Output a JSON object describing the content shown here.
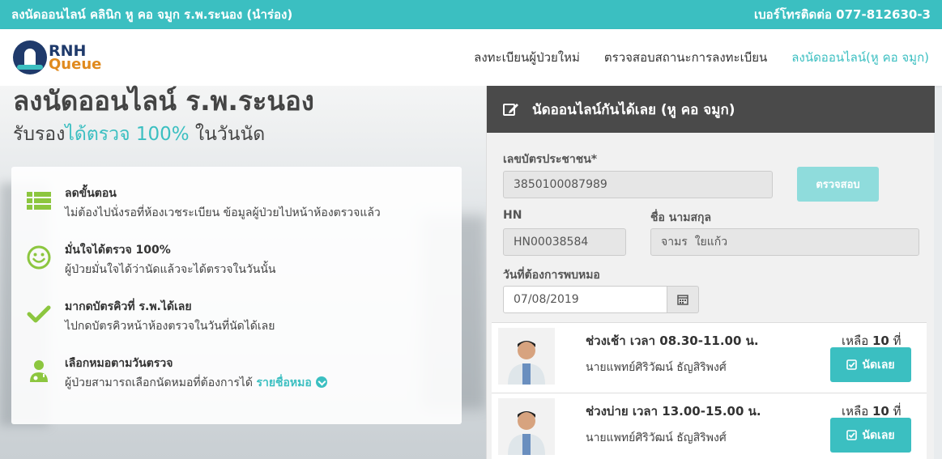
{
  "topbar": {
    "title": "ลงนัดออนไลน์ คลินิก หู คอ จมูก ร.พ.ระนอง (นำร่อง)",
    "phone": "เบอร์โทรติดต่อ 077-812630-3"
  },
  "logo": {
    "line1": "RNH",
    "line2": "Queue"
  },
  "menu": [
    "ลงทะเบียนผู้ป่วยใหม่",
    "ตรวจสอบสถานะการลงทะเบียน",
    "ลงนัดออนไลน์(หู คอ จมูก)"
  ],
  "hero": {
    "title": "ลงนัดออนไลน์ ร.พ.ระนอง",
    "sub_prefix": "รับรอง",
    "sub_highlight": "ได้ตรวจ 100%",
    "sub_suffix": " ในวันนัด"
  },
  "features": [
    {
      "title": "ลดขั้นตอน",
      "desc": "ไม่ต้องไปนั่งรอที่ห้องเวชระเบียน ข้อมูลผู้ป่วยไปหน้าห้องตรวจแล้ว",
      "icon": "list-icon"
    },
    {
      "title": "มั่นใจได้ตรวจ 100%",
      "desc": "ผู้ป่วยมั่นใจได้ว่านัดแล้วจะได้ตรวจในวันนั้น",
      "icon": "smile-icon"
    },
    {
      "title": "มากดบัตรคิวที่ ร.พ.ได้เลย",
      "desc": "ไปกดบัตรคิวหน้าห้องตรวจในวันที่นัดได้เลย",
      "icon": "check-icon"
    },
    {
      "title": "เลือกหมอตามวันตรวจ",
      "desc": "ผู้ป่วยสามารถเลือกนัดหมอที่ต้องการได้",
      "link": "รายชื่อหมอ",
      "icon": "doctor-icon"
    }
  ],
  "panel": {
    "title": "นัดออนไลน์กันได้เลย (หู คอ จมูก)",
    "id_label": "เลขบัตรประชาชน*",
    "id_value": "3850100087989",
    "check_button": "ตรวจสอบ",
    "hn_label": "HN",
    "hn_value": "HN00038584",
    "name_label": "ชื่อ นามสกุล",
    "name_value": "จามร  ใยแก้ว",
    "date_label": "วันที่ต้องการพบหมอ",
    "date_value": "07/08/2019"
  },
  "slots": [
    {
      "time": "ช่วงเช้า เวลา 08.30-11.00 น.",
      "doctor": "นายแพทย์ศิริวัฒน์ ธัญสิริพงศ์",
      "remaining_label": "เหลือ",
      "remaining": "10",
      "unit": "ที่",
      "button": "นัดเลย"
    },
    {
      "time": "ช่วงบ่าย เวลา 13.00-15.00 น.",
      "doctor": "นายแพทย์ศิริวัฒน์ ธัญสิริพงศ์",
      "remaining_label": "เหลือ",
      "remaining": "10",
      "unit": "ที่",
      "button": "นัดเลย"
    }
  ],
  "colors": {
    "accent": "#3bbfc1",
    "header_dark": "#4a4a4a",
    "feature_green": "#8cc63f"
  }
}
